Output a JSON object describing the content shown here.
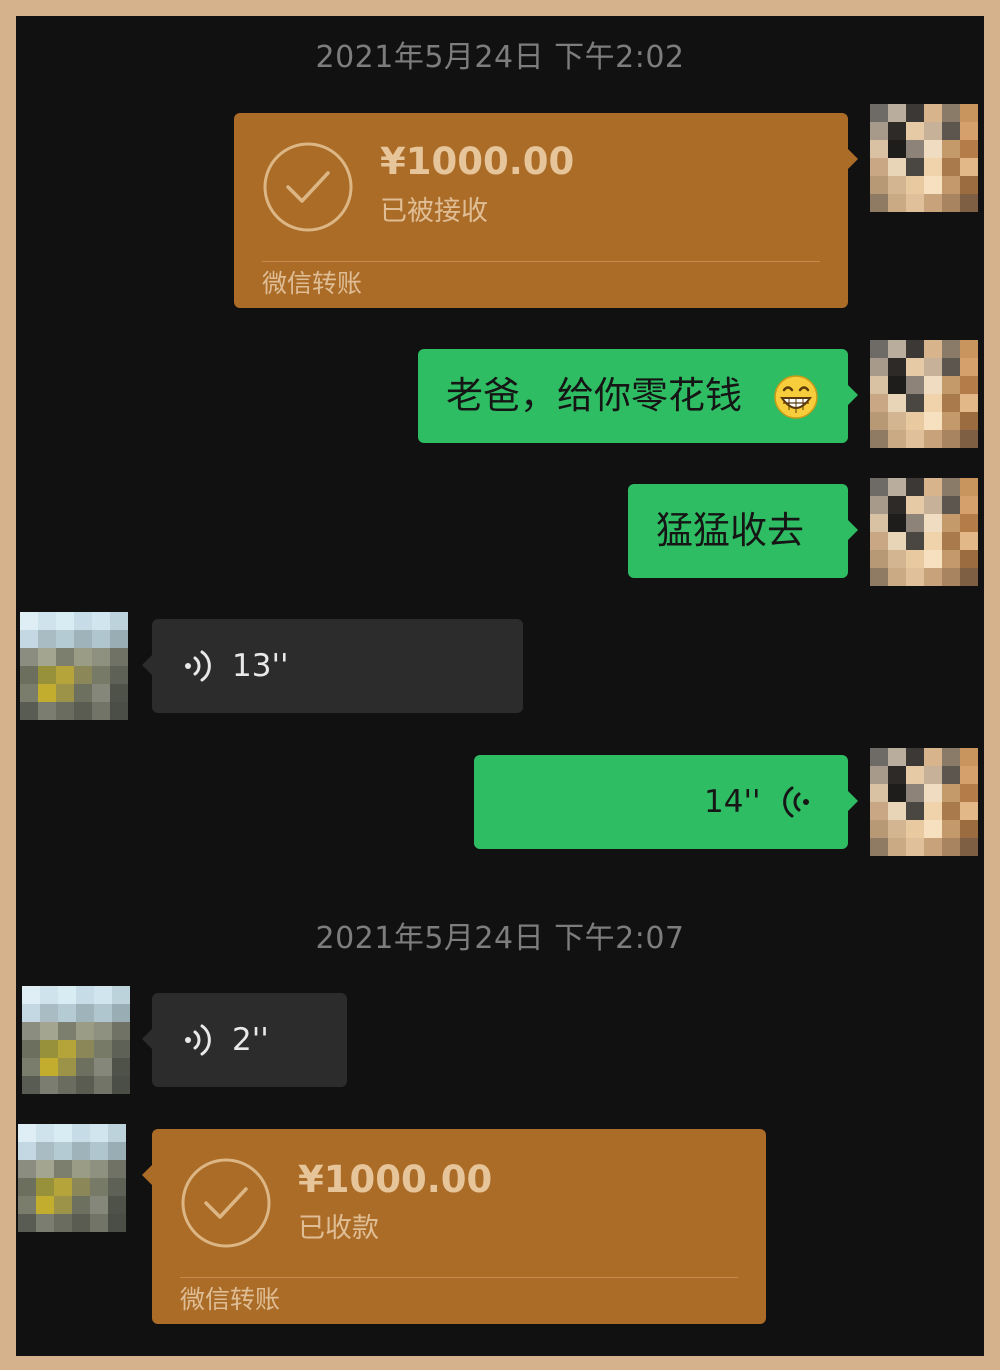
{
  "timestamps": [
    "2021年5月24日 下午2:02",
    "2021年5月24日 下午2:07"
  ],
  "messages": {
    "transfer_sent": {
      "amount": "¥1000.00",
      "status": "已被接收",
      "footer": "微信转账",
      "icon": "check-circle-icon"
    },
    "text_1": {
      "text": "老爸，给你零花钱",
      "emoji": "grinning-face-emoji"
    },
    "text_2": {
      "text": "猛猛收去"
    },
    "voice_received_1": {
      "duration": "13''",
      "icon": "voice-wave-icon"
    },
    "voice_sent": {
      "duration": "14''",
      "icon": "voice-wave-icon"
    },
    "voice_received_2": {
      "duration": "2''",
      "icon": "voice-wave-icon"
    },
    "transfer_received": {
      "amount": "¥1000.00",
      "status": "已收款",
      "footer": "微信转账",
      "icon": "check-circle-icon"
    }
  },
  "colors": {
    "background": "#111111",
    "frame": "#d6b28c",
    "sent_bubble": "#2fbd63",
    "received_bubble": "#2c2c2c",
    "transfer_bubble": "#ab6c28",
    "timestamp_text": "#7d7d7d"
  }
}
